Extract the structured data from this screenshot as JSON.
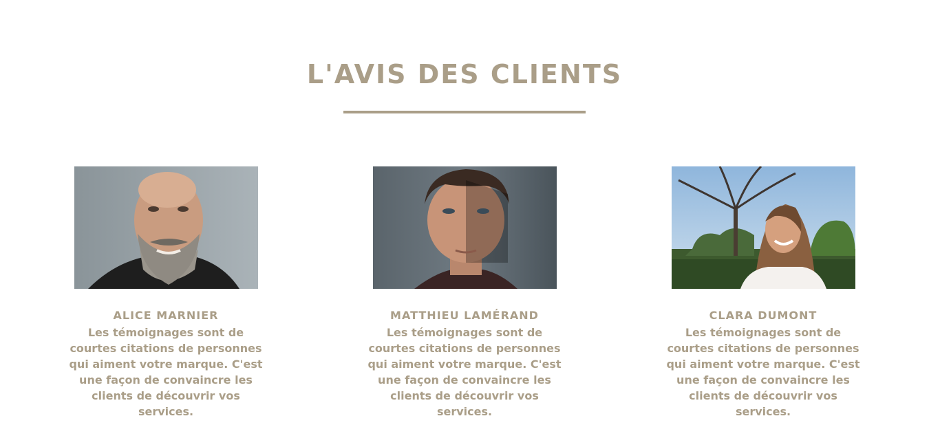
{
  "section": {
    "title": "L'AVIS DES CLIENTS"
  },
  "testimonials": [
    {
      "name": "ALICE MARNIER",
      "quote": "Les témoignages sont de courtes citations de personnes qui aiment votre marque. C'est une façon de convaincre les clients de découvrir vos services."
    },
    {
      "name": "MATTHIEU LAMÉRAND",
      "quote": "Les témoignages sont de courtes citations de personnes qui aiment votre marque. C'est une façon de convaincre les clients de découvrir vos services."
    },
    {
      "name": "CLARA DUMONT",
      "quote": "Les témoignages sont de courtes citations de personnes qui aiment votre marque. C'est une façon de convaincre les clients de découvrir vos services."
    }
  ],
  "colors": {
    "accent": "#aa9e88",
    "background": "#ffffff"
  }
}
